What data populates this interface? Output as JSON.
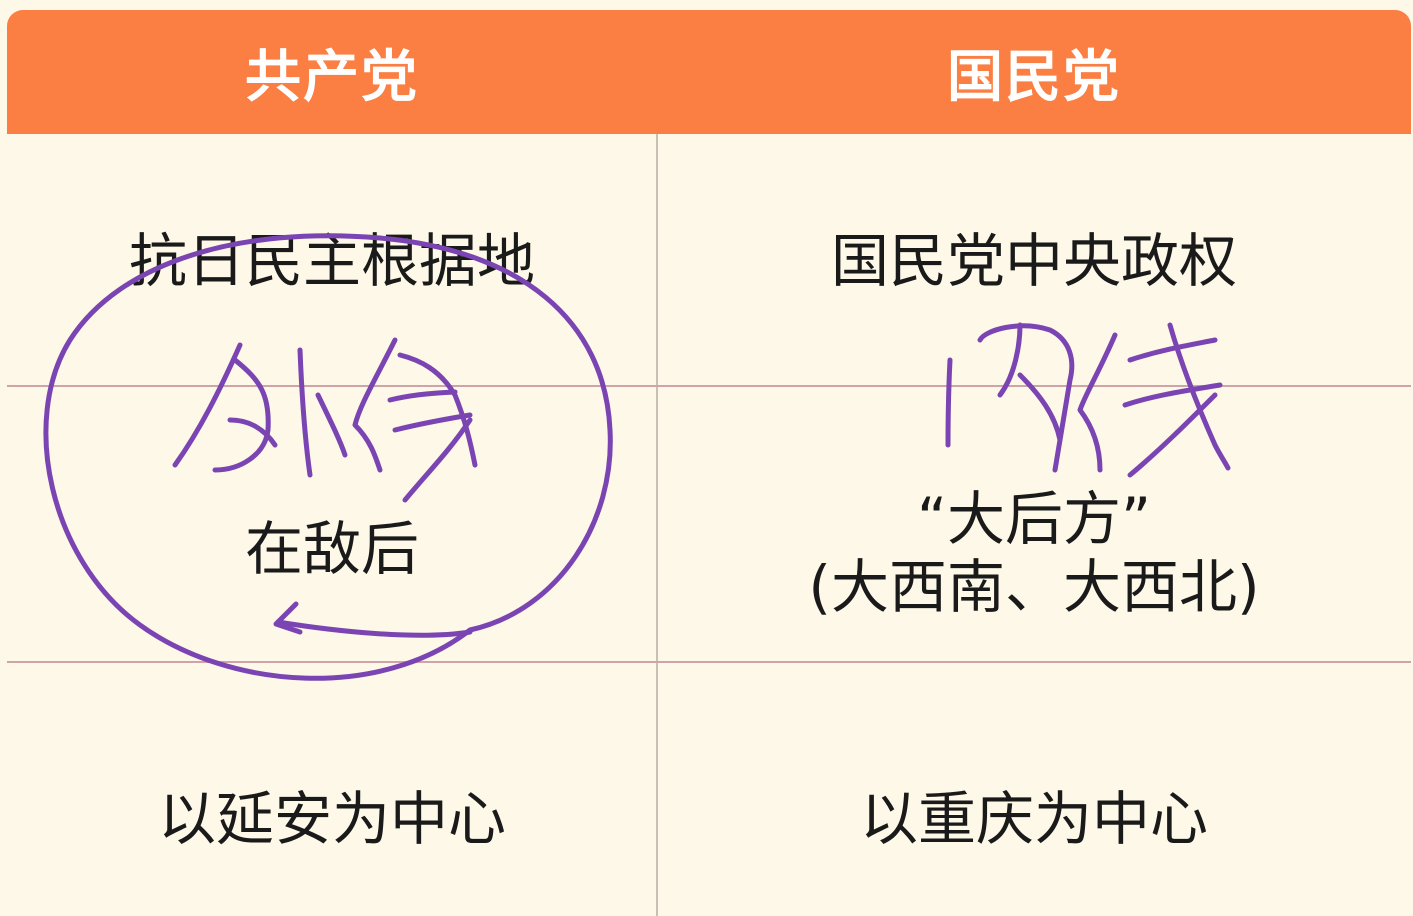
{
  "header": {
    "left": "共产党",
    "right": "国民党"
  },
  "rows": [
    {
      "left": "抗日民主根据地",
      "right": "国民党中央政权"
    },
    {
      "left": "在敌后",
      "right_line1": "“大后方”",
      "right_line2": "(大西南、大西北)"
    },
    {
      "left": "以延安为中心",
      "right": "以重庆为中心"
    }
  ],
  "annotations": {
    "left_handwriting": "外线",
    "right_handwriting": "内线",
    "ink_color": "#7a45b3"
  },
  "colors": {
    "header_bg": "#fb7e42",
    "body_bg": "#fdf8e7",
    "row_divider": "#cfa4a8"
  }
}
